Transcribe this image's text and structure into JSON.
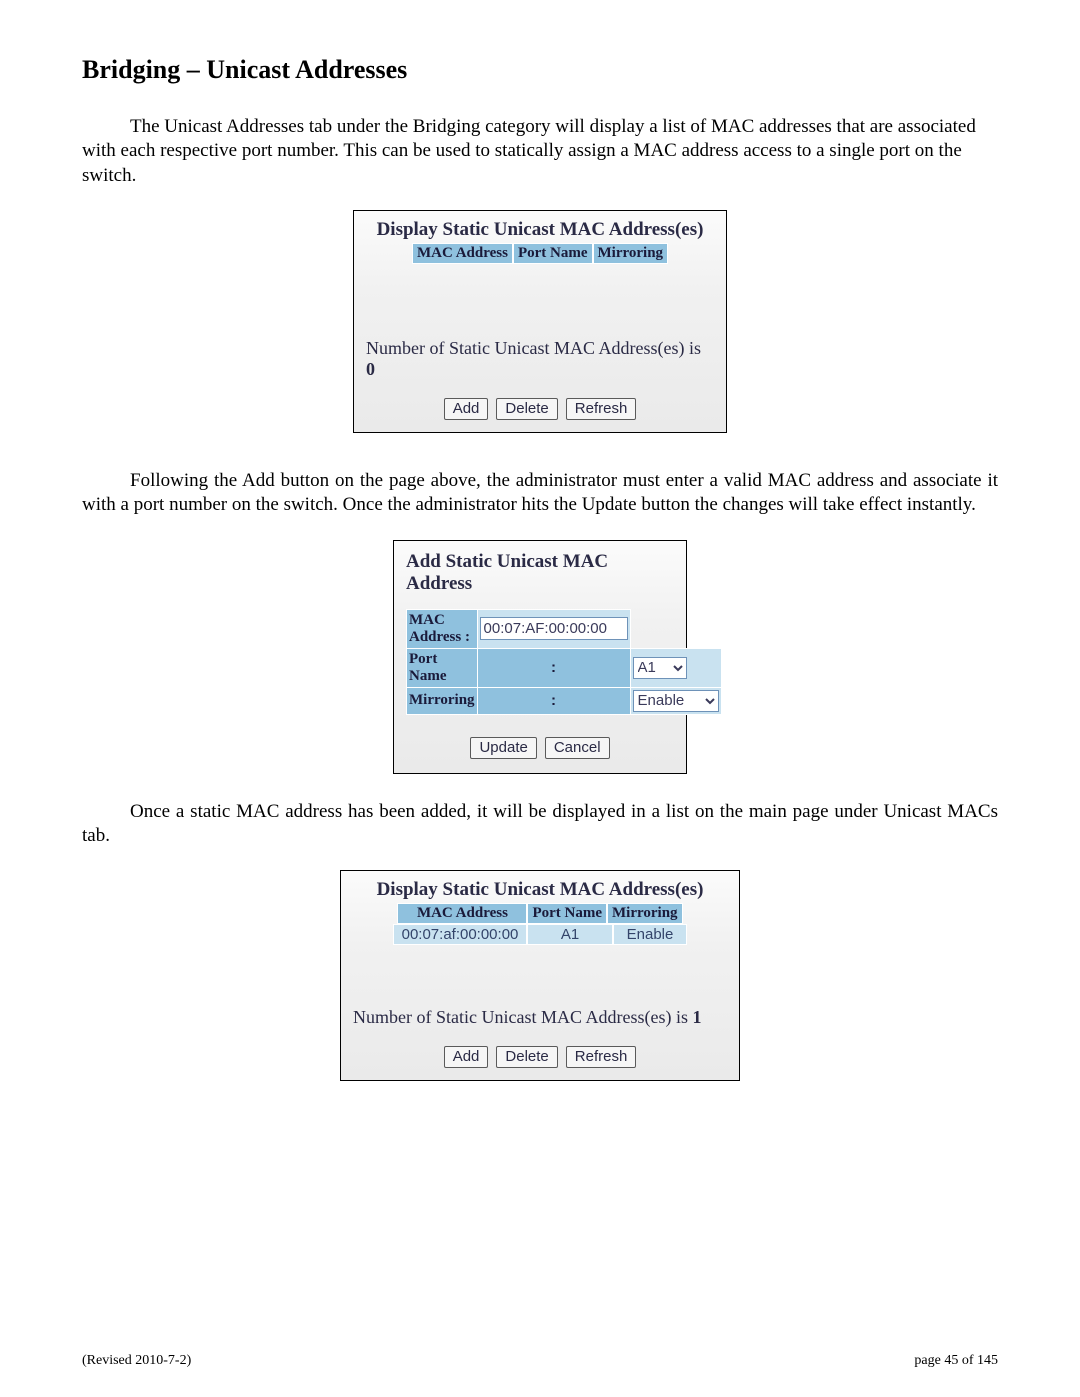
{
  "title": "Bridging – Unicast Addresses",
  "para1": "The Unicast Addresses tab under the Bridging category will display a list of MAC addresses that are associated with each respective port number.  This can be used to statically assign a MAC address access to a single port on the switch.",
  "para2": "Following the Add button on the page above, the administrator must enter a valid MAC address and associate it with a port number on the switch.  Once the administrator hits the Update button the changes will take effect instantly.",
  "para3": "Once a static MAC address has been added, it will be displayed in a list on the main page under Unicast MACs tab.",
  "panel1": {
    "title": "Display Static Unicast MAC Address(es)",
    "cols": {
      "c1": "MAC Address",
      "c2": "Port Name",
      "c3": "Mirroring"
    },
    "countPrefix": "Number of Static Unicast MAC Address(es) is ",
    "countValue": "0",
    "btns": {
      "add": "Add",
      "delete": "Delete",
      "refresh": "Refresh"
    }
  },
  "panel2": {
    "title": "Add Static Unicast MAC Address",
    "labels": {
      "mac": "MAC Address",
      "port": "Port Name",
      "mirr": "Mirroring"
    },
    "values": {
      "mac": "00:07:AF:00:00:00",
      "port": "A1",
      "mirr": "Enable"
    },
    "btns": {
      "update": "Update",
      "cancel": "Cancel"
    }
  },
  "panel3": {
    "title": "Display Static Unicast MAC Address(es)",
    "cols": {
      "c1": "MAC Address",
      "c2": "Port Name",
      "c3": "Mirroring"
    },
    "row": {
      "mac": "00:07:af:00:00:00",
      "port": "A1",
      "mirr": "Enable"
    },
    "countPrefix": "Number of Static Unicast MAC Address(es) is ",
    "countValue": "1",
    "btns": {
      "add": "Add",
      "delete": "Delete",
      "refresh": "Refresh"
    }
  },
  "footer": {
    "left": "(Revised 2010-7-2)",
    "right": "page 45 of 145"
  }
}
